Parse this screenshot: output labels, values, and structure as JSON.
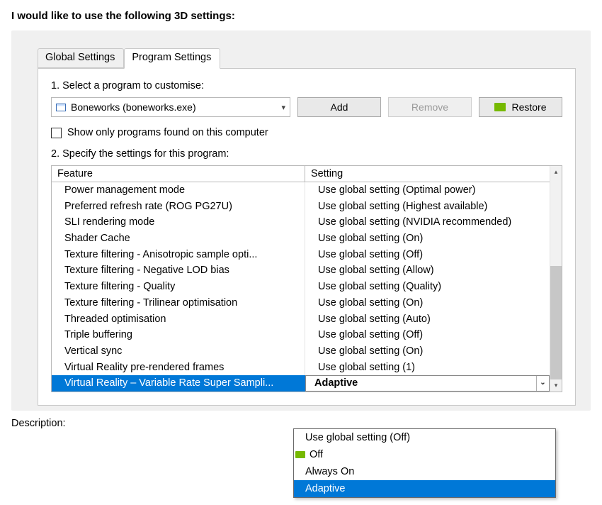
{
  "heading": "I would like to use the following 3D settings:",
  "tabs": {
    "global": "Global Settings",
    "program": "Program Settings"
  },
  "step1_label": "1. Select a program to customise:",
  "program_combo": {
    "value": "Boneworks (boneworks.exe)"
  },
  "buttons": {
    "add": "Add",
    "remove": "Remove",
    "restore": "Restore"
  },
  "show_only_label": "Show only programs found on this computer",
  "step2_label": "2. Specify the settings for this program:",
  "columns": {
    "feature": "Feature",
    "setting": "Setting"
  },
  "rows": [
    {
      "feature": "Power management mode",
      "setting": "Use global setting (Optimal power)"
    },
    {
      "feature": "Preferred refresh rate (ROG PG27U)",
      "setting": "Use global setting (Highest available)"
    },
    {
      "feature": "SLI rendering mode",
      "setting": "Use global setting (NVIDIA recommended)"
    },
    {
      "feature": "Shader Cache",
      "setting": "Use global setting (On)"
    },
    {
      "feature": "Texture filtering - Anisotropic sample opti...",
      "setting": "Use global setting (Off)"
    },
    {
      "feature": "Texture filtering - Negative LOD bias",
      "setting": "Use global setting (Allow)"
    },
    {
      "feature": "Texture filtering - Quality",
      "setting": "Use global setting (Quality)"
    },
    {
      "feature": "Texture filtering - Trilinear optimisation",
      "setting": "Use global setting (On)"
    },
    {
      "feature": "Threaded optimisation",
      "setting": "Use global setting (Auto)"
    },
    {
      "feature": "Triple buffering",
      "setting": "Use global setting (Off)"
    },
    {
      "feature": "Vertical sync",
      "setting": "Use global setting (On)"
    },
    {
      "feature": "Virtual Reality pre-rendered frames",
      "setting": "Use global setting (1)"
    },
    {
      "feature": "Virtual Reality – Variable Rate Super Sampli...",
      "setting": "Adaptive"
    }
  ],
  "dropdown": {
    "options": [
      "Use global setting (Off)",
      "Off",
      "Always On",
      "Adaptive"
    ],
    "selected": "Adaptive"
  },
  "description_label": "Description:"
}
